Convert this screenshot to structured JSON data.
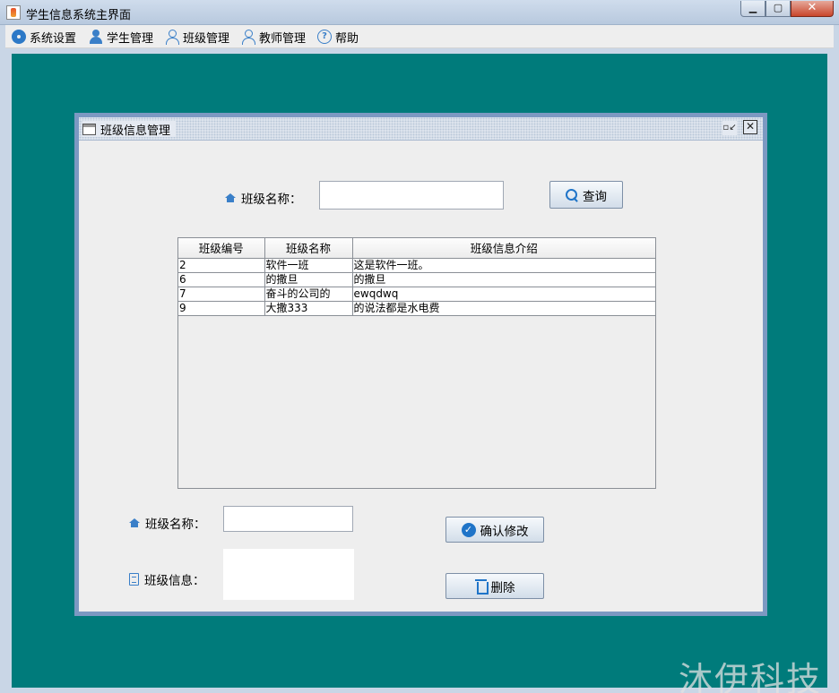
{
  "window": {
    "title": "学生信息系统主界面",
    "controls": {
      "minimize": "▁",
      "maximize": "▢",
      "close": "✕"
    }
  },
  "menubar": {
    "items": [
      {
        "label": "系统设置",
        "icon": "gear-icon"
      },
      {
        "label": "学生管理",
        "icon": "student-icon"
      },
      {
        "label": "班级管理",
        "icon": "users-icon"
      },
      {
        "label": "教师管理",
        "icon": "teacher-icon"
      },
      {
        "label": "帮助",
        "icon": "help-icon"
      }
    ]
  },
  "internal_frame": {
    "title": "班级信息管理",
    "restore_glyph": "▫↙",
    "close_glyph": "✕"
  },
  "search": {
    "label": "班级名称：",
    "value": "",
    "button_label": "查询"
  },
  "table": {
    "columns": [
      "班级编号",
      "班级名称",
      "班级信息介绍"
    ],
    "rows": [
      [
        "2",
        "软件一班",
        "这是软件一班。"
      ],
      [
        "6",
        "的撒旦",
        "的撒旦"
      ],
      [
        "7",
        "奋斗的公司的",
        "ewqdwq"
      ],
      [
        "9",
        "大撒333",
        "的说法都是水电费"
      ]
    ]
  },
  "edit": {
    "name_label": "班级名称：",
    "name_value": "",
    "info_label": "班级信息：",
    "info_value": "",
    "confirm_label": "确认修改",
    "delete_label": "删除"
  },
  "watermark": "沐伊科技",
  "colors": {
    "desktop": "#007b7b",
    "frame_border": "#7c99c2",
    "accent_icon": "#1f74c8"
  }
}
